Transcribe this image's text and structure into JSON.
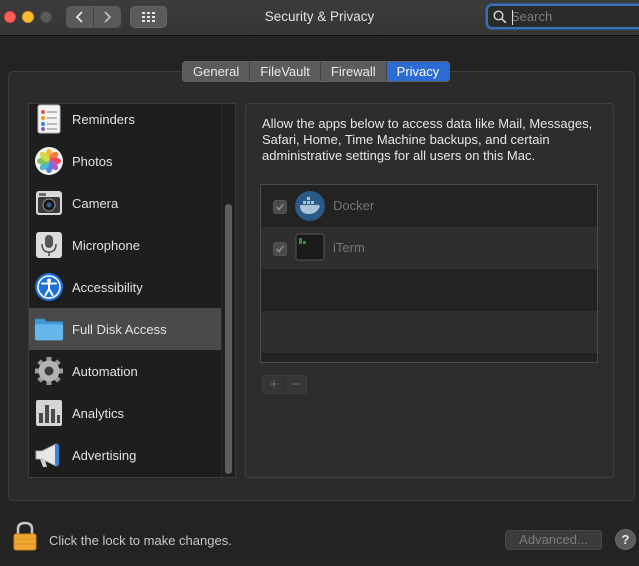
{
  "window": {
    "title": "Security & Privacy"
  },
  "search": {
    "placeholder": "Search"
  },
  "tabs": [
    {
      "label": "General",
      "active": false
    },
    {
      "label": "FileVault",
      "active": false
    },
    {
      "label": "Firewall",
      "active": false
    },
    {
      "label": "Privacy",
      "active": true
    }
  ],
  "categories": [
    {
      "label": "Reminders",
      "icon": "reminders-icon",
      "selected": false
    },
    {
      "label": "Photos",
      "icon": "photos-icon",
      "selected": false
    },
    {
      "label": "Camera",
      "icon": "camera-icon",
      "selected": false
    },
    {
      "label": "Microphone",
      "icon": "microphone-icon",
      "selected": false
    },
    {
      "label": "Accessibility",
      "icon": "accessibility-icon",
      "selected": false
    },
    {
      "label": "Full Disk Access",
      "icon": "folder-icon",
      "selected": true
    },
    {
      "label": "Automation",
      "icon": "gear-icon",
      "selected": false
    },
    {
      "label": "Analytics",
      "icon": "analytics-icon",
      "selected": false
    },
    {
      "label": "Advertising",
      "icon": "megaphone-icon",
      "selected": false
    }
  ],
  "privacy": {
    "description": "Allow the apps below to access data like Mail, Messages, Safari, Home, Time Machine backups, and certain administrative settings for all users on this Mac.",
    "apps": [
      {
        "name": "Docker",
        "checked": true,
        "icon": "docker-icon"
      },
      {
        "name": "iTerm",
        "checked": true,
        "icon": "terminal-icon"
      }
    ],
    "add_label": "+",
    "remove_label": "−"
  },
  "footer": {
    "lock_text": "Click the lock to make changes.",
    "advanced_label": "Advanced...",
    "help_label": "?"
  },
  "colors": {
    "accent": "#2c6ad4",
    "close": "#ff5f57",
    "minimize": "#febc2e"
  }
}
